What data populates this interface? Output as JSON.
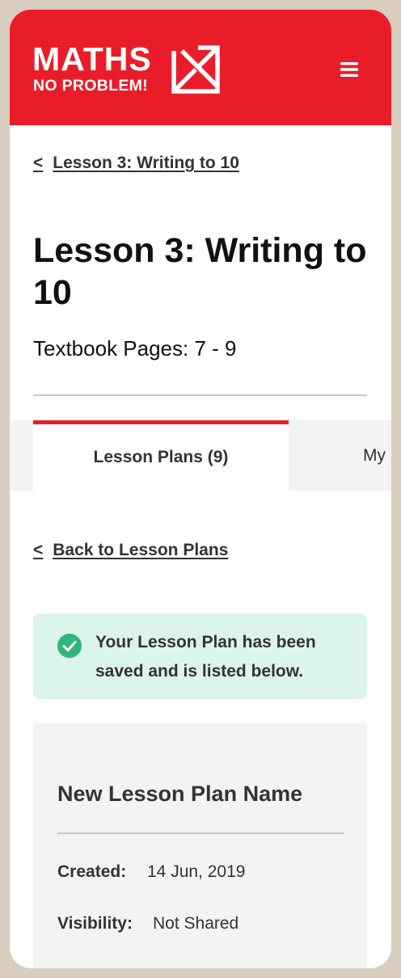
{
  "brand": {
    "logo_line1": "MATHS",
    "logo_line2": "NO PROBLEM!",
    "header_color": "#e91d29"
  },
  "header": {
    "menu_icon": "hamburger-menu-icon"
  },
  "breadcrumb": {
    "chevron": "<",
    "label": "Lesson 3: Writing to 10"
  },
  "page": {
    "title": "Lesson 3: Writing to 10",
    "subtitle": "Textbook Pages: 7 - 9"
  },
  "tabs": [
    {
      "label": "Lesson Plans (9)",
      "active": true
    },
    {
      "label": "My",
      "active": false
    }
  ],
  "back_link": {
    "chevron": "<",
    "label": "Back to Lesson Plans"
  },
  "alert": {
    "icon": "check-circle-icon",
    "message": "Your Lesson Plan has been saved and is listed below.",
    "color": "#dcf5ea",
    "icon_color": "#2fb67c"
  },
  "lesson_plan": {
    "name": "New Lesson Plan Name",
    "created_label": "Created:",
    "created_value": "14 Jun, 2019",
    "visibility_label": "Visibility:",
    "visibility_value": "Not Shared"
  }
}
